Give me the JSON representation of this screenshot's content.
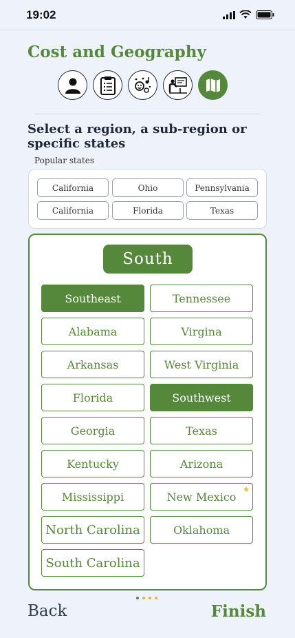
{
  "status": {
    "time": "19:02"
  },
  "page": {
    "title": "Cost and Geography",
    "section_title": "Select a region, a sub-region or specific states",
    "popular_label": "Popular states"
  },
  "steps": [
    {
      "icon": "person-icon",
      "active": false
    },
    {
      "icon": "clipboard-icon",
      "active": false
    },
    {
      "icon": "arts-icon",
      "active": false
    },
    {
      "icon": "teacher-icon",
      "active": false
    },
    {
      "icon": "map-icon",
      "active": true
    }
  ],
  "popular_states": [
    "California",
    "Ohio",
    "Pennsylvania",
    "California",
    "Florida",
    "Texas"
  ],
  "region": {
    "name": "South",
    "options": [
      {
        "label": "Southeast",
        "selected": true
      },
      {
        "label": "Tennessee",
        "selected": false
      },
      {
        "label": "Alabama",
        "selected": false
      },
      {
        "label": "Virgina",
        "selected": false
      },
      {
        "label": "Arkansas",
        "selected": false
      },
      {
        "label": "West Virginia",
        "selected": false
      },
      {
        "label": "Florida",
        "selected": false
      },
      {
        "label": "Southwest",
        "selected": true
      },
      {
        "label": "Georgia",
        "selected": false
      },
      {
        "label": "Texas",
        "selected": false
      },
      {
        "label": "Kentucky",
        "selected": false
      },
      {
        "label": "Arizona",
        "selected": false
      },
      {
        "label": "Mississippi",
        "selected": false
      },
      {
        "label": "New Mexico",
        "selected": false,
        "starred": true
      },
      {
        "label": "North Carolina",
        "selected": false
      },
      {
        "label": "Oklahoma",
        "selected": false
      },
      {
        "label": "South Carolina",
        "selected": false
      }
    ]
  },
  "nav": {
    "back": "Back",
    "finish": "Finish"
  },
  "colors": {
    "accent": "#55883a",
    "background": "#eef2fa",
    "star": "#f0b429"
  }
}
